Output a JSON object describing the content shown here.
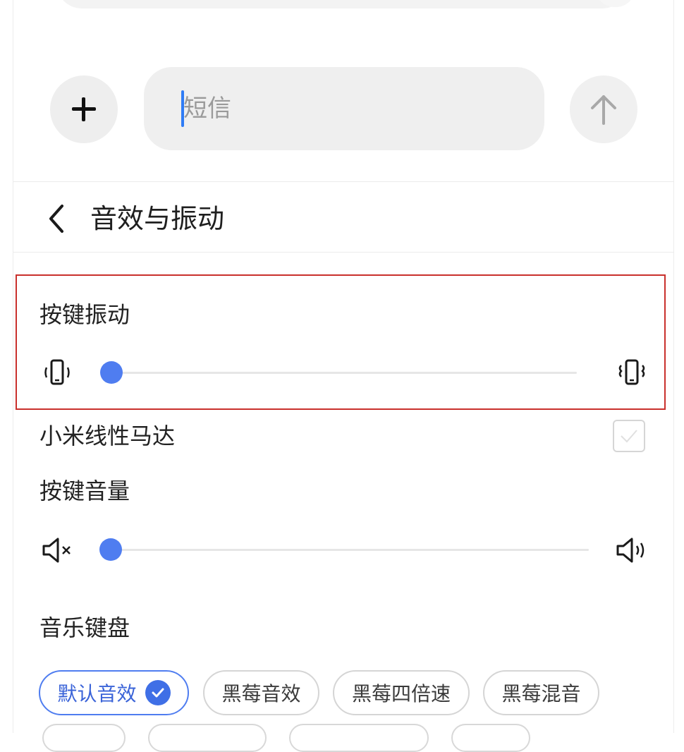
{
  "compose": {
    "placeholder": "短信",
    "add_icon": "plus-icon",
    "send_icon": "arrow-up-icon"
  },
  "header": {
    "back_icon": "chevron-left-icon",
    "title": "音效与振动"
  },
  "key_vibration": {
    "label": "按键振动",
    "level": 0.0,
    "low_icon": "vibrate-low-icon",
    "high_icon": "vibrate-high-icon"
  },
  "linear_motor": {
    "label": "小米线性马达",
    "checked": false
  },
  "key_volume": {
    "label": "按键音量",
    "level": 0.0,
    "low_icon": "volume-mute-icon",
    "high_icon": "volume-up-icon"
  },
  "music_keyboard": {
    "label": "音乐键盘",
    "options": [
      {
        "label": "默认音效",
        "selected": true
      },
      {
        "label": "黑莓音效",
        "selected": false
      },
      {
        "label": "黑莓四倍速",
        "selected": false
      },
      {
        "label": "黑莓混音",
        "selected": false
      }
    ]
  },
  "colors": {
    "accent": "#4f7df0",
    "highlight_border": "#c9302c",
    "caret": "#2f7cf6"
  }
}
